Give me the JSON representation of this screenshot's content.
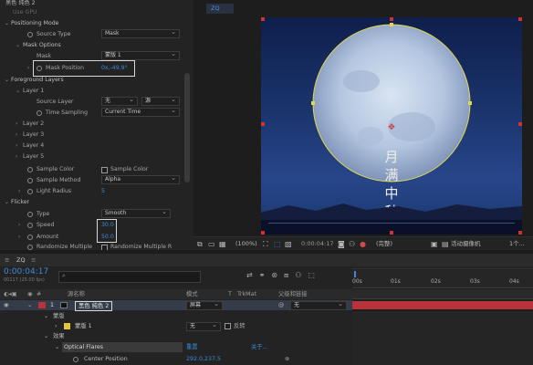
{
  "effect_controls": {
    "layer_title": "黑色 纯色 2",
    "top_truncated": "Use GPU",
    "positioning_mode": "Positioning Mode",
    "source_type_label": "Source Type",
    "source_type_value": "Mask",
    "mask_options": "Mask Options",
    "mask_label": "Mask",
    "mask_value": "蒙版 1",
    "mask_position_label": "Mask Position",
    "mask_position_value": "0x,-49.9°",
    "foreground_layers": "Foreground Layers",
    "layer1": "Layer 1",
    "source_layer_label": "Source Layer",
    "source_layer_value": "无",
    "source_layer_opt": "源",
    "time_sampling_label": "Time Sampling",
    "time_sampling_value": "Current Time",
    "layer2": "Layer 2",
    "layer3": "Layer 3",
    "layer4": "Layer 4",
    "layer5": "Layer 5",
    "sample_color_label": "Sample Color",
    "sample_color_check": "Sample Color",
    "sample_method_label": "Sample Method",
    "sample_method_value": "Alpha",
    "light_radius_label": "Light Radius",
    "light_radius_value": "5",
    "flicker": "Flicker",
    "type_label": "Type",
    "type_value": "Smooth",
    "speed_label": "Speed",
    "speed_value": "30.0",
    "amount_label": "Amount",
    "amount_value": "50.0",
    "randomize_label": "Randomize Multiple",
    "randomize_check": "Randomize Multiple R"
  },
  "viewer": {
    "tab": "ZQ",
    "poster_text": [
      "月",
      "满",
      "中",
      "秋"
    ],
    "zoom": "(100%)",
    "timecode": "0:00:04:17",
    "quality": "(完整)",
    "camera": "活动摄像机",
    "views": "1个..."
  },
  "timeline": {
    "tab": "ZQ",
    "timecode": "0:00:04:17",
    "frame_info": "00117 (25.00 fps)",
    "search_placeholder": "",
    "col_source": "源名称",
    "col_mode": "模式",
    "col_t": "T",
    "col_trkmat": "TrkMat",
    "col_parent": "父级和链接",
    "layer_num": "1",
    "layer_name": "黑色 纯色 2",
    "layer_mode": "屏幕",
    "layer_parent": "无",
    "masks": "蒙版",
    "mask1": "蒙版 1",
    "mask1_mode": "无",
    "mask1_invert": "反转",
    "effects": "效果",
    "optical_flares": "Optical Flares",
    "reset": "重置",
    "about": "关于...",
    "center_position": "Center Position",
    "center_value": "292.0,237.5",
    "ruler_ticks": [
      "00s",
      "01s",
      "02s",
      "03s",
      "04s"
    ]
  },
  "colors": {
    "accent_blue": "#3a8bd8",
    "layer_red": "#b8323a",
    "mask_yellow": "#e3c63a",
    "playhead": "#4b7fd8"
  }
}
